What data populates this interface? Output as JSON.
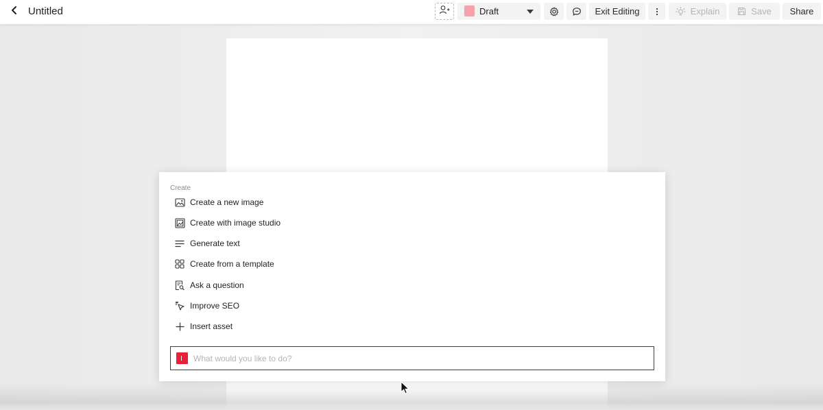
{
  "header": {
    "title": "Untitled",
    "status": {
      "label": "Draft",
      "swatch_color": "#f7a1ad"
    },
    "buttons": {
      "exit_editing": "Exit Editing",
      "explain": "Explain",
      "save": "Save",
      "share": "Share"
    },
    "icons": {
      "back": "chevron-left-icon",
      "add_user": "add-user-icon",
      "settings": "gear-icon",
      "comments": "comment-icon",
      "more": "more-vertical-icon",
      "explain": "lightbulb-icon",
      "save": "save-icon"
    }
  },
  "create_panel": {
    "heading": "Create",
    "items": [
      {
        "label": "Create a new image",
        "icon": "image-icon"
      },
      {
        "label": "Create with image studio",
        "icon": "image-studio-icon"
      },
      {
        "label": "Generate text",
        "icon": "text-lines-icon"
      },
      {
        "label": "Create from a template",
        "icon": "template-grid-icon"
      },
      {
        "label": "Ask a question",
        "icon": "document-search-icon"
      },
      {
        "label": "Improve SEO",
        "icon": "sparkle-cursor-icon"
      },
      {
        "label": "Insert asset",
        "icon": "plus-icon"
      }
    ],
    "prompt": {
      "placeholder": "What would you like to do?",
      "value": "",
      "badge_color": "#e8203a"
    }
  }
}
